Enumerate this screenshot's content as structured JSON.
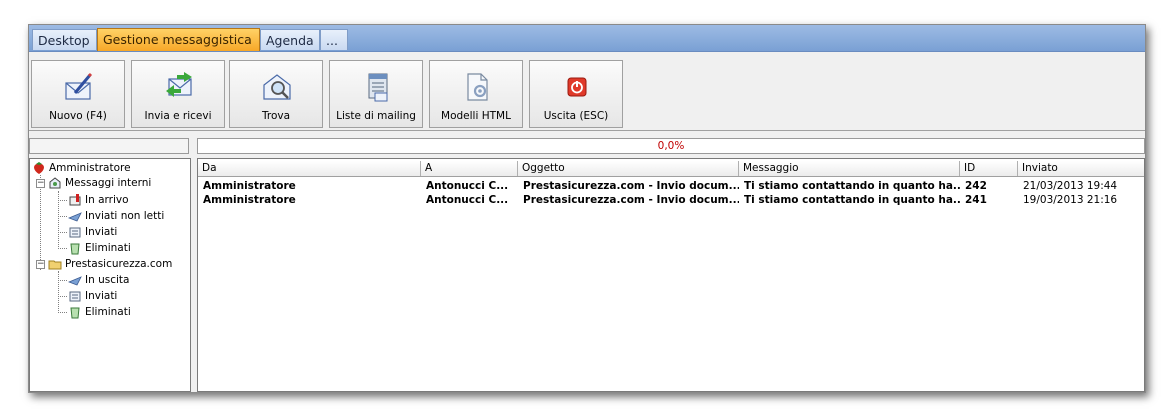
{
  "tabs": [
    {
      "label": "Desktop",
      "active": false
    },
    {
      "label": "Gestione messaggistica",
      "active": true
    },
    {
      "label": "Agenda",
      "active": false
    },
    {
      "label": "...",
      "active": false
    }
  ],
  "toolbar": {
    "buttons": [
      {
        "label": "Nuovo (F4)",
        "icon": "envelope-pen-icon"
      },
      {
        "label": "Invia e ricevi",
        "icon": "send-receive-icon"
      },
      {
        "label": "Trova",
        "icon": "search-envelope-icon"
      },
      {
        "label": "Liste di mailing",
        "icon": "mailing-list-icon"
      },
      {
        "label": "Modelli HTML",
        "icon": "html-template-icon"
      },
      {
        "label": "Uscita (ESC)",
        "icon": "exit-power-icon"
      }
    ]
  },
  "progress": {
    "text": "0,0%",
    "value": 0.0,
    "color": "#c00000"
  },
  "tree": {
    "root": "Amministratore",
    "groups": [
      {
        "label": "Messaggi interni",
        "children": [
          "In arrivo",
          "Inviati non letti",
          "Inviati",
          "Eliminati"
        ]
      },
      {
        "label": "Prestasicurezza.com",
        "children": [
          "In uscita",
          "Inviati",
          "Eliminati"
        ]
      }
    ]
  },
  "grid": {
    "columns": [
      "Da",
      "A",
      "Oggetto",
      "Messaggio",
      "ID",
      "Inviato"
    ],
    "rows": [
      {
        "da": "Amministratore",
        "a": "Antonucci C...",
        "oggetto": "Prestasicurezza.com - Invio docum...",
        "messaggio": "Ti stiamo contattando in quanto ha...",
        "id": "242",
        "inviato": "21/03/2013 19:44"
      },
      {
        "da": "Amministratore",
        "a": "Antonucci C...",
        "oggetto": "Prestasicurezza.com - Invio docum...",
        "messaggio": "Ti stiamo contattando in quanto ha...",
        "id": "241",
        "inviato": "19/03/2013 21:16"
      }
    ]
  },
  "colors": {
    "tabbar": "#7aa0d4",
    "active_tab": "#f7a728",
    "progress_text": "#c00000"
  }
}
